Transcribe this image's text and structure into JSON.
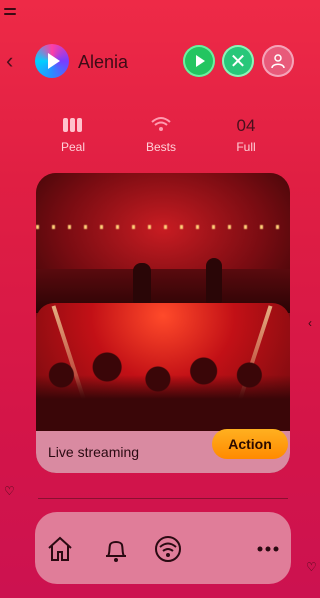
{
  "header": {
    "brand": "Alenia"
  },
  "stats": [
    {
      "icon": "bars-icon",
      "label": "Peal"
    },
    {
      "icon": "wifi-icon",
      "label": "Bests"
    },
    {
      "value": "04",
      "label": "Full"
    }
  ],
  "card": {
    "title": "Live streaming",
    "action_label": "Action"
  },
  "nav": {
    "items": [
      "home-icon",
      "bell-icon",
      "wifi-icon",
      "more-icon"
    ]
  },
  "colors": {
    "background": "#e01f43",
    "accent": "#ff8a00",
    "card_footer": "#d98aa1"
  }
}
